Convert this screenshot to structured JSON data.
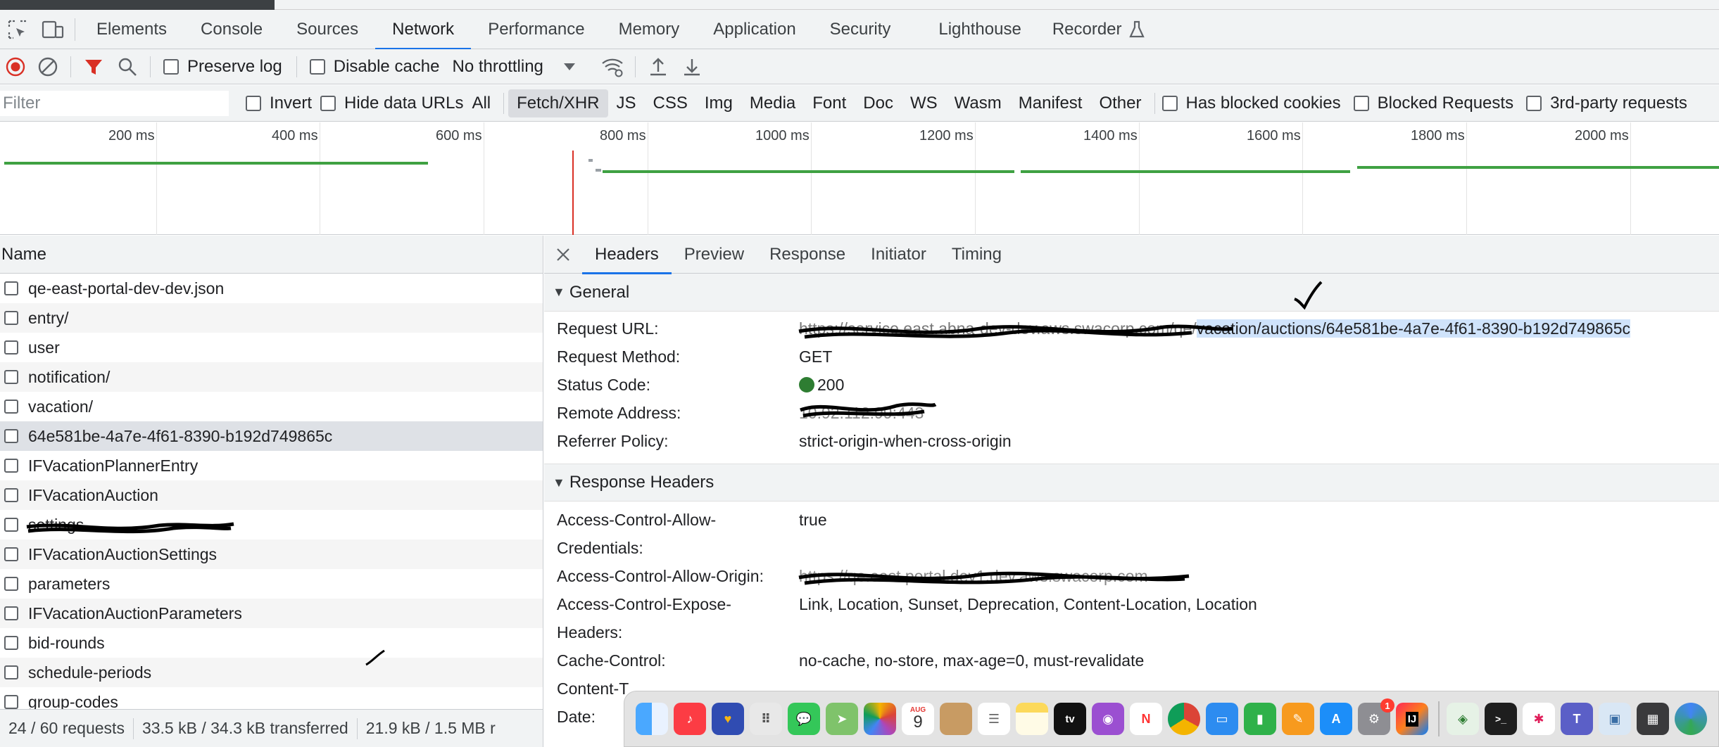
{
  "devtools": {
    "tabs": [
      "Elements",
      "Console",
      "Sources",
      "Network",
      "Performance",
      "Memory",
      "Application",
      "Security",
      "Lighthouse",
      "Recorder"
    ],
    "active_tab": "Network"
  },
  "toolbar": {
    "preserve_log": "Preserve log",
    "disable_cache": "Disable cache",
    "throttling": "No throttling"
  },
  "filter": {
    "placeholder": "Filter",
    "invert": "Invert",
    "hide_data_urls": "Hide data URLs",
    "types": [
      "All",
      "Fetch/XHR",
      "JS",
      "CSS",
      "Img",
      "Media",
      "Font",
      "Doc",
      "WS",
      "Wasm",
      "Manifest",
      "Other"
    ],
    "active_type": "Fetch/XHR",
    "has_blocked_cookies": "Has blocked cookies",
    "blocked_requests": "Blocked Requests",
    "third_party": "3rd-party requests"
  },
  "overview": {
    "ticks": [
      "200 ms",
      "400 ms",
      "600 ms",
      "800 ms",
      "1000 ms",
      "1200 ms",
      "1400 ms",
      "1600 ms",
      "1800 ms",
      "2000 ms"
    ]
  },
  "request_list": {
    "column_name": "Name",
    "rows": [
      "qe-east-portal-dev-dev.json",
      "entry/",
      "user",
      "notification/",
      "vacation/",
      "64e581be-4a7e-4f61-8390-b192d749865c",
      "IFVacationPlannerEntry",
      "IFVacationAuction",
      "settings",
      "IFVacationAuctionSettings",
      "parameters",
      "IFVacationAuctionParameters",
      "bid-rounds",
      "schedule-periods",
      "group-codes"
    ],
    "selected_index": 5
  },
  "status_bar": {
    "requests": "24 / 60 requests",
    "transferred": "33.5 kB / 34.3 kB transferred",
    "resources": "21.9 kB / 1.5 MB r"
  },
  "details": {
    "tabs": [
      "Headers",
      "Preview",
      "Response",
      "Initiator",
      "Timing"
    ],
    "active_tab": "Headers",
    "general": {
      "title": "General",
      "request_url_label": "Request URL:",
      "request_url_redacted": "https://service.east.abna-dev-dev.aws.swacorp.com/qe/",
      "request_url_highlighted": "vacation/auctions/64e581be-4a7e-4f61-8390-b192d749865c",
      "method_label": "Request Method:",
      "method": "GET",
      "status_label": "Status Code:",
      "status": "200",
      "remote_label": "Remote Address:",
      "remote": "10.92.112.99:443",
      "referrer_label": "Referrer Policy:",
      "referrer": "strict-origin-when-cross-origin"
    },
    "response_headers": {
      "title": "Response Headers",
      "acac_label_1": "Access-Control-Allow-",
      "acac_label_2": "Credentials:",
      "acac": "true",
      "acao_label": "Access-Control-Allow-Origin:",
      "acao": "https://qe.east.portal.dev1.dev.aws.swacorp.com",
      "aceh_label_1": "Access-Control-Expose-",
      "aceh_label_2": "Headers:",
      "aceh": "Link, Location, Sunset, Deprecation, Content-Location, Location",
      "cc_label": "Cache-Control:",
      "cc": "no-cache, no-store, max-age=0, must-revalidate",
      "ct_label": "Content-T",
      "date_label": "Date:"
    }
  },
  "dock": {
    "calendar_month": "AUG",
    "calendar_day": "9",
    "tv_label": "tv",
    "badge": "1",
    "ij_label": "IJ"
  },
  "colors": {
    "accent": "#1a73e8",
    "record_red": "#d93025",
    "status_green": "#2e7d32",
    "timeline_green": "#3fa142",
    "selection_highlight": "#cfe3fb"
  }
}
